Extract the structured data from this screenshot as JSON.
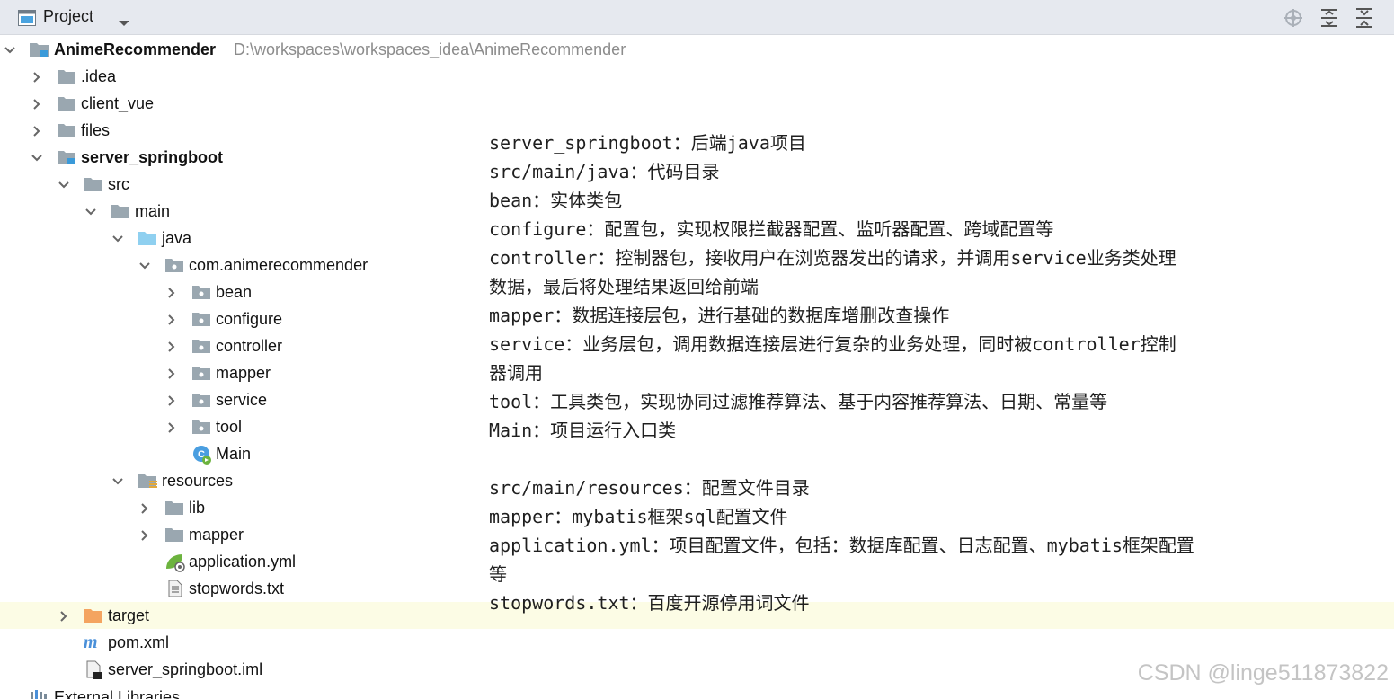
{
  "header": {
    "title": "Project",
    "icons": [
      "project-view-icon",
      "dropdown-icon",
      "locate-icon",
      "expand-all-icon",
      "collapse-all-icon"
    ]
  },
  "tree": {
    "root": {
      "label": "AnimeRecommender",
      "path": "D:\\workspaces\\workspaces_idea\\AnimeRecommender"
    },
    "items": {
      "idea": ".idea",
      "client_vue": "client_vue",
      "files": "files",
      "server_springboot": "server_springboot",
      "src": "src",
      "main": "main",
      "java": "java",
      "package": "com.animerecommender",
      "bean": "bean",
      "configure": "configure",
      "controller": "controller",
      "mapper": "mapper",
      "service": "service",
      "tool": "tool",
      "main_class": "Main",
      "resources": "resources",
      "lib": "lib",
      "res_mapper": "mapper",
      "application_yml": "application.yml",
      "stopwords": "stopwords.txt",
      "target": "target",
      "pom": "pom.xml",
      "iml": "server_springboot.iml",
      "external": "External Libraries"
    }
  },
  "notes": [
    "server_springboot：后端java项目",
    "src/main/java：代码目录",
    "bean：实体类包",
    "configure：配置包，实现权限拦截器配置、监听器配置、跨域配置等",
    "controller：控制器包，接收用户在浏览器发出的请求，并调用service业务类处理",
    "数据，最后将处理结果返回给前端",
    "mapper：数据连接层包，进行基础的数据库增删改查操作",
    "service：业务层包，调用数据连接层进行复杂的业务处理，同时被controller控制",
    "器调用",
    "tool：工具类包，实现协同过滤推荐算法、基于内容推荐算法、日期、常量等",
    "Main：项目运行入口类",
    "",
    "src/main/resources：配置文件目录",
    "mapper：mybatis框架sql配置文件",
    "application.yml：项目配置文件，包括：数据库配置、日志配置、mybatis框架配置",
    "等",
    "stopwords.txt：百度开源停用词文件"
  ],
  "watermark": "CSDN @linge511873822",
  "colors": {
    "header_bg": "#e6e9ef",
    "folder_gray": "#9aa7b0",
    "folder_blue": "#8fd0f0",
    "folder_orange": "#f4a460",
    "highlight_row": "#fcfce5"
  }
}
